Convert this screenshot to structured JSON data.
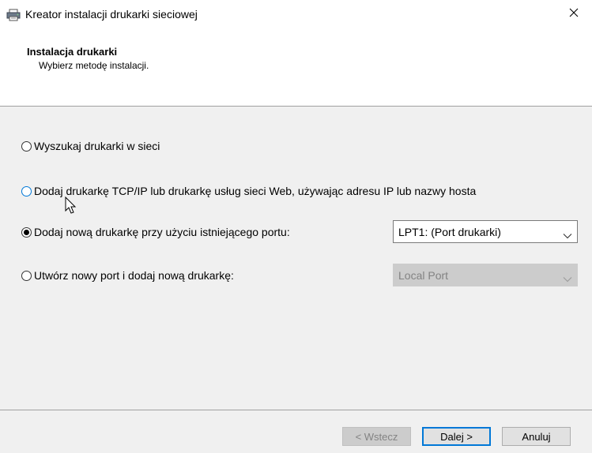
{
  "window": {
    "title": "Kreator instalacji drukarki sieciowej"
  },
  "header": {
    "title": "Instalacja drukarki",
    "subtitle": "Wybierz metodę instalacji."
  },
  "options": {
    "search": {
      "label": "Wyszukaj drukarki w sieci",
      "checked": false
    },
    "tcpip": {
      "label": "Dodaj drukarkę TCP/IP lub drukarkę usług sieci Web, używając adresu IP lub nazwy hosta",
      "checked": false,
      "focused": true
    },
    "existing_port": {
      "label": "Dodaj nową drukarkę przy użyciu istniejącego portu:",
      "checked": true,
      "select_value": "LPT1: (Port drukarki)"
    },
    "new_port": {
      "label": "Utwórz nowy port i dodaj nową drukarkę:",
      "checked": false,
      "select_value": "Local Port",
      "select_disabled": true
    }
  },
  "buttons": {
    "back": "< Wstecz",
    "next": "Dalej >",
    "cancel": "Anuluj"
  },
  "colors": {
    "accent": "#0078d7",
    "body_bg": "#f0f0f0",
    "disabled_bg": "#cccccc",
    "disabled_text": "#838383"
  },
  "icons": {
    "app": "printer-icon",
    "close": "close-icon",
    "dropdown": "chevron-down-icon",
    "pointer": "mouse-cursor-icon"
  }
}
